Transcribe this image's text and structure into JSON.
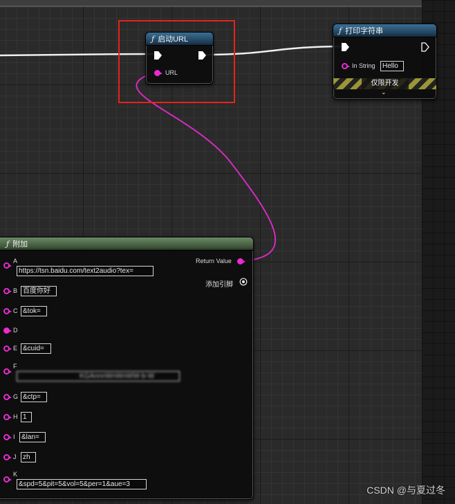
{
  "launch_node": {
    "title": "启动URL",
    "url_pin_label": "URL"
  },
  "print_node": {
    "title": "打印字符串",
    "in_string_label": "In String",
    "in_string_value": "Hello",
    "dev_banner_label": "仅限开发"
  },
  "append_node": {
    "title": "附加",
    "return_value_label": "Return Value",
    "add_pin_label": "添加引脚",
    "pins": [
      {
        "label": "A",
        "value": "https://tsn.baidu.com/text2audio?tex="
      },
      {
        "label": "B",
        "value": "百度你好"
      },
      {
        "label": "C",
        "value": "&tok="
      },
      {
        "label": "D",
        "value": ""
      },
      {
        "label": "E",
        "value": "&cuid="
      },
      {
        "label": "F",
        "value": "KGAnnnWnWnWW-b-W"
      },
      {
        "label": "G",
        "value": "&ctp="
      },
      {
        "label": "H",
        "value": "1"
      },
      {
        "label": "I",
        "value": "&lan="
      },
      {
        "label": "J",
        "value": "zh"
      },
      {
        "label": "K",
        "value": "&spd=5&pit=5&vol=5&per=1&aue=3"
      }
    ]
  },
  "watermark": "CSDN @与夏过冬",
  "colors": {
    "string_pin": "#e92bd0",
    "highlight": "#e8231b",
    "function_header": "#3b6f95",
    "pure_header": "#6a8a63"
  },
  "icons": {
    "function": "function-icon",
    "exec": "exec-pin-icon",
    "add_pin": "add-pin-icon",
    "expand": "chevron-down-icon"
  }
}
